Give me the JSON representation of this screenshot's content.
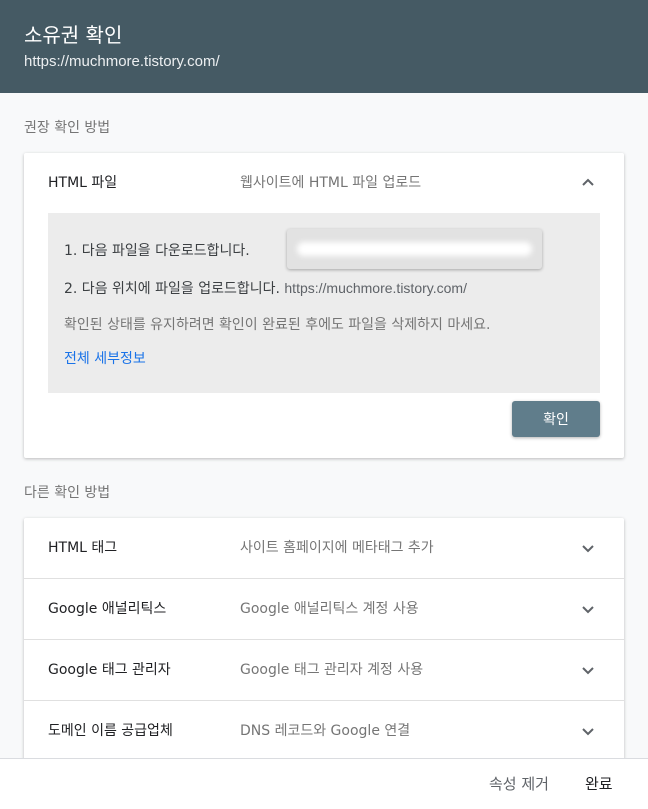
{
  "header": {
    "title": "소유권 확인",
    "url": "https://muchmore.tistory.com/"
  },
  "recommended": {
    "label": "권장 확인 방법",
    "method": {
      "name": "HTML 파일",
      "description": "웹사이트에 HTML 파일 업로드",
      "chevron_icon": "chevron-up-icon",
      "step1": "1. 다음 파일을 다운로드합니다.",
      "step2_prefix": "2. 다음 위치에 파일을 업로드합니다.",
      "step2_url": "https://muchmore.tistory.com/",
      "note": "확인된 상태를 유지하려면 확인이 완료된 후에도 파일을 삭제하지 마세요.",
      "details_link": "전체 세부정보",
      "confirm_button": "확인"
    }
  },
  "other": {
    "label": "다른 확인 방법",
    "methods": [
      {
        "name": "HTML 태그",
        "description": "사이트 홈페이지에 메타태그 추가"
      },
      {
        "name": "Google 애널리틱스",
        "description": "Google 애널리틱스 계정 사용"
      },
      {
        "name": "Google 태그 관리자",
        "description": "Google 태그 관리자 계정 사용"
      },
      {
        "name": "도메인 이름 공급업체",
        "description": "DNS 레코드와 Google 연결"
      }
    ]
  },
  "footer": {
    "remove_property": "속성 제거",
    "done": "완료"
  },
  "colors": {
    "header_bg": "#455a64",
    "button_bg": "#607d8b",
    "link": "#1a73e8"
  }
}
